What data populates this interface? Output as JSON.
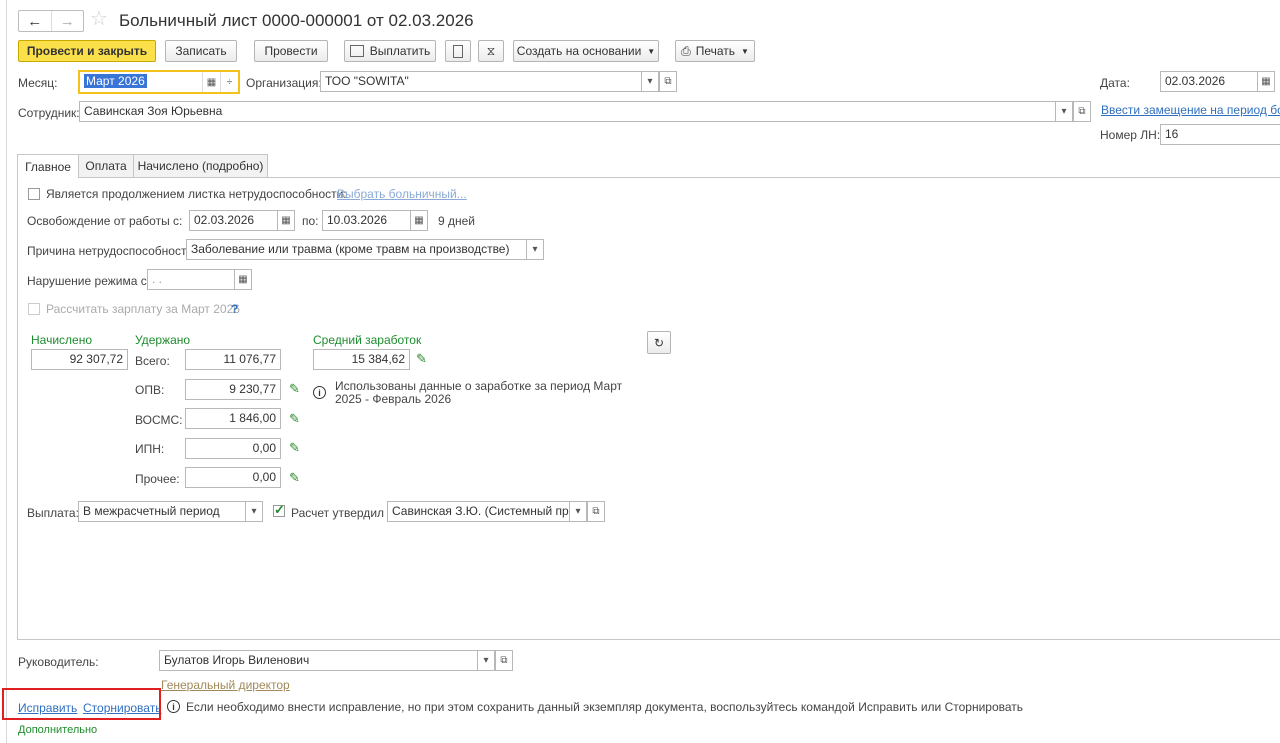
{
  "window": {
    "title": "Больничный лист 0000-000001 от 02.03.2026"
  },
  "toolbar": {
    "post_close": "Провести и закрыть",
    "save": "Записать",
    "post": "Провести",
    "pay": "Выплатить",
    "create_based": "Создать на основании",
    "print": "Печать"
  },
  "header": {
    "month_label": "Месяц:",
    "month_value": "Март 2026",
    "org_label": "Организация:",
    "org_value": "ТОО \"SOWITA\"",
    "date_label": "Дата:",
    "date_value": "02.03.2026",
    "employee_label": "Сотрудник:",
    "employee_value": "Савинская Зоя Юрьевна",
    "replacement_link": "Ввести замещение на период бол",
    "ln_label": "Номер ЛН:",
    "ln_value": "16"
  },
  "tabs": [
    "Главное",
    "Оплата",
    "Начислено (подробно)"
  ],
  "main": {
    "continuation_label": "Является продолжением листка нетрудоспособности:",
    "choose_sick_link": "Выбрать больничный...",
    "release_label": "Освобождение от работы с:",
    "release_from": "02.03.2026",
    "to_label": "по:",
    "release_to": "10.03.2026",
    "days": "9 дней",
    "reason_label": "Причина нетрудоспособности:",
    "reason_value": "Заболевание или травма (кроме травм на производстве)",
    "violation_label": "Нарушение режима с:",
    "violation_value": ". .",
    "calc_salary_label": "Рассчитать зарплату за Март 2026",
    "help_mark": "?",
    "accrued_header": "Начислено",
    "withheld_header": "Удержано",
    "avg_header": "Средний заработок",
    "accrued_value": "92 307,72",
    "total_label": "Всего:",
    "total_value": "11 076,77",
    "avg_value": "15 384,62",
    "opv_label": "ОПВ:",
    "opv_value": "9 230,77",
    "info_text": "Использованы данные о заработке за период Март 2025 - Февраль 2026",
    "vosms_label": "ВОСМС:",
    "vosms_value": "1 846,00",
    "ipn_label": "ИПН:",
    "ipn_value": "0,00",
    "other_label": "Прочее:",
    "other_value": "0,00",
    "payout_label": "Выплата:",
    "payout_value": "В межрасчетный период",
    "approved_label": "Расчет утвердил",
    "approved_value": "Савинская З.Ю. (Системный прог"
  },
  "footer": {
    "head_label": "Руководитель:",
    "head_value": "Булатов Игорь Виленович",
    "head_position": "Генеральный директор",
    "fix_link": "Исправить",
    "storno_link": "Сторнировать",
    "hint": "Если необходимо внести исправление, но при этом сохранить данный экземпляр документа, воспользуйтесь командой Исправить или Сторнировать",
    "additional": "Дополнительно"
  },
  "colors": {
    "primary_button": "#fbe04a",
    "link": "#2f6fbf",
    "green_label": "#1e8c2e",
    "focus": "#f3c21a",
    "highlight": "#e02020"
  }
}
